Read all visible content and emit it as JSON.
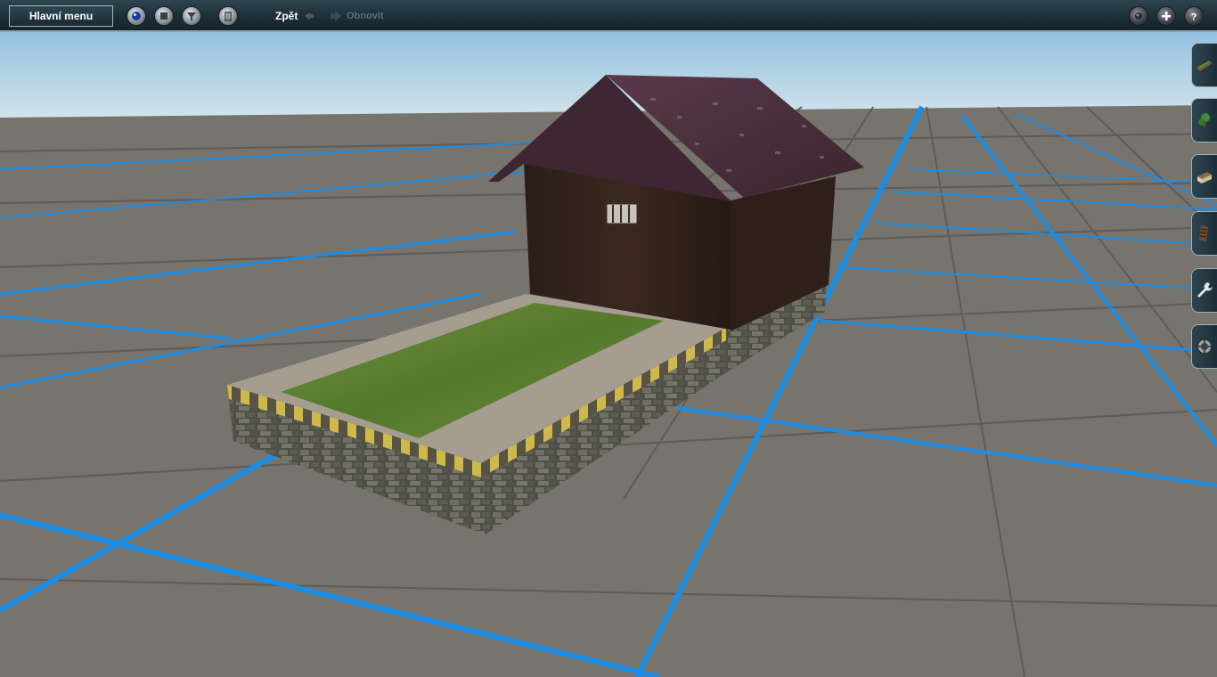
{
  "toolbar": {
    "main_menu_label": "Hlavní menu",
    "undo_label": "Zpět",
    "redo_label": "Obnovit",
    "left_buttons": [
      "globe-icon",
      "stop-icon",
      "filter-icon",
      "trash-icon"
    ],
    "right_buttons": [
      "mode-icon",
      "plus-icon",
      "help-icon"
    ]
  },
  "side_tabs": [
    "track-icon",
    "scenery-icon",
    "building-icon",
    "rail-segment-icon",
    "wrench-icon",
    "settings-wheel-icon"
  ],
  "colors": {
    "toolbar": "#1f3039",
    "grid_line": "#1a8de6",
    "ground": "#77736d",
    "sky": "#bcd8e8"
  }
}
